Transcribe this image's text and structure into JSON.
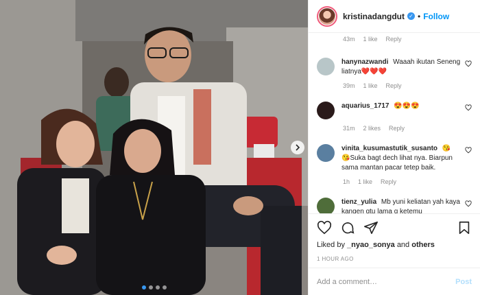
{
  "header": {
    "username": "kristinadangdut",
    "separator": "•",
    "follow_label": "Follow"
  },
  "top_meta": {
    "time": "43m",
    "likes": "1 like",
    "reply": "Reply"
  },
  "comments": [
    {
      "username": "hanynazwandi",
      "text": "Waaah ikutan Seneng liatnya❤️❤️❤️",
      "time": "39m",
      "likes": "1 like",
      "reply": "Reply",
      "avatar_color": "#b8c6c8"
    },
    {
      "username": "aquarius_1717",
      "text": "😍😍😍",
      "time": "31m",
      "likes": "2 likes",
      "reply": "Reply",
      "avatar_color": "#2a1a1a"
    },
    {
      "username": "vinita_kusumastutik_susanto",
      "text": "😘 😘Suka bagt dech lihat nya. Biarpun sama mantan pacar tetep baik.",
      "time": "1h",
      "likes": "1 like",
      "reply": "Reply",
      "avatar_color": "#5a7fa0"
    },
    {
      "username": "tienz_yulia",
      "text": "Mb yuni keliatan yah kaya kangen gtu lama g ketemu",
      "avatar_color": "#4f6d3a"
    }
  ],
  "liked_by": {
    "prefix": "Liked by",
    "user": "_nyao_sonya",
    "and": "and",
    "others": "others"
  },
  "timestamp": "1 HOUR AGO",
  "add_comment": {
    "placeholder": "Add a comment…",
    "post_label": "Post"
  },
  "carousel": {
    "total": 4,
    "active_index": 0
  }
}
